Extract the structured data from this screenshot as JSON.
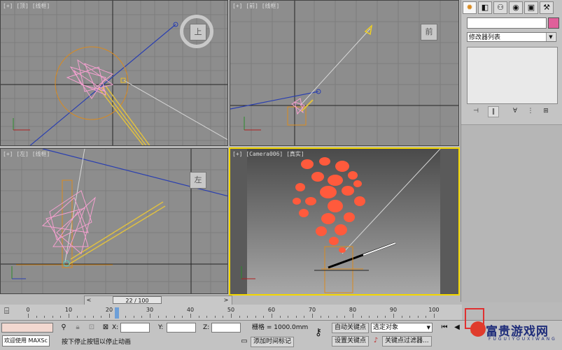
{
  "viewports": {
    "top": {
      "label": "[+] [顶] [线框]",
      "cube": "上"
    },
    "front": {
      "label": "[+] [前] [线框]",
      "cube": "前"
    },
    "left": {
      "label": "[+] [左] [线框]",
      "cube": "左"
    },
    "camera": {
      "label": "[+] [Camera006] [真实]"
    }
  },
  "command_panel": {
    "tabs": [
      "create-tab",
      "modify-tab",
      "hierarchy-tab",
      "motion-tab",
      "display-tab",
      "utilities-tab"
    ],
    "modifier_list": "修改器列表",
    "color_swatch": "#e0609a"
  },
  "time_slider": {
    "label": "22 / 100",
    "current_frame": 22,
    "total_frames": 100
  },
  "timeline": {
    "ticks": [
      "0",
      "10",
      "20",
      "30",
      "40",
      "50",
      "60",
      "70",
      "80",
      "90",
      "100"
    ]
  },
  "status_bar": {
    "welcome": "欢迎使用 MAXSc",
    "prompt": "按下停止按钮以停止动画",
    "x_label": "X:",
    "y_label": "Y:",
    "z_label": "Z:",
    "grid": "栅格 = 1000.0mm",
    "add_time_tag": "添加时间标记",
    "auto_key": "自动关键点",
    "set_key": "设置关键点",
    "selected_object": "选定对象",
    "key_filters": "关键点过滤器..."
  },
  "watermark": {
    "text": "富贵游戏网",
    "sub": "FUGUIYOUXIWANG"
  },
  "colors": {
    "accent_viewport": "#f3d700",
    "highlight": "#e03030",
    "particles": "#ff5a3c"
  }
}
